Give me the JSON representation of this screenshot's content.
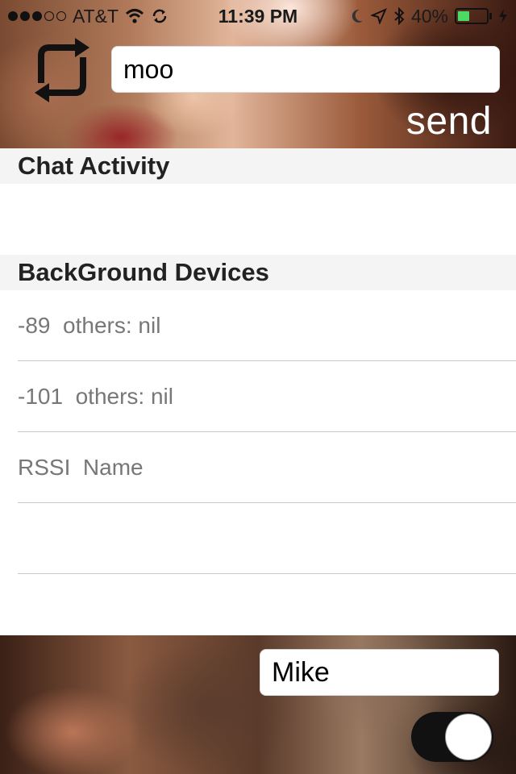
{
  "status_bar": {
    "carrier": "AT&T",
    "time": "11:39 PM",
    "battery": "40%",
    "battery_level": 0.4,
    "signal_bars_filled": 3,
    "signal_bars_total": 5,
    "icons": [
      "wifi-icon",
      "sync-status-icon",
      "moon-icon",
      "location-arrow-icon",
      "bluetooth-icon",
      "battery-icon",
      "charging-bolt-icon"
    ]
  },
  "composer": {
    "message_value": "moo",
    "send_label": "send",
    "refresh_icon": "refresh-icon"
  },
  "sections": {
    "chat_activity": "Chat Activity",
    "background_devices": "BackGround Devices"
  },
  "device_rows": [
    {
      "text": "-89  others: nil"
    },
    {
      "text": "-101  others: nil"
    },
    {
      "text": "RSSI  Name"
    },
    {
      "text": ""
    }
  ],
  "footer": {
    "name_value": "Mike",
    "toggle_on": true
  },
  "colors": {
    "section_bg": "#f4f4f4",
    "row_text": "#777777",
    "separator": "#c8c7cc",
    "toggle_on": "#111111"
  }
}
